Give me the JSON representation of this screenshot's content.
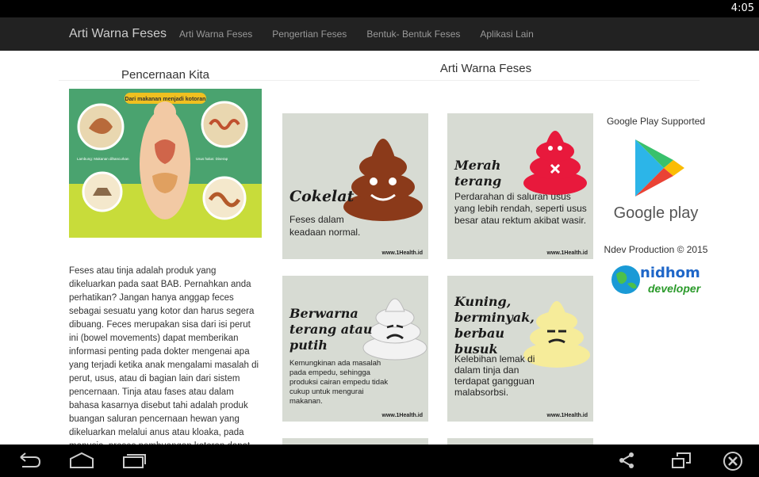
{
  "status_bar": {
    "time": "4:05"
  },
  "navbar": {
    "brand": "Arti Warna Feses",
    "links": [
      "Arti Warna Feses",
      "Pengertian Feses",
      "Bentuk- Bentuk Feses",
      "Aplikasi Lain"
    ]
  },
  "left": {
    "title": "Pencernaan Kita",
    "image_caption": "Dari makanan menjadi kotoran",
    "body": "Feses atau tinja adalah produk yang dikeluarkan pada saat BAB. Pernahkan anda perhatikan? Jangan hanya anggap feces sebagai sesuatu yang kotor dan harus segera dibuang. Feces merupakan sisa dari isi perut ini (bowel movements) dapat memberikan informasi penting pada dokter mengenai apa yang terjadi ketika anak mengalami masalah di perut, usus, atau di bagian lain dari sistem pencernaan. Tinja atau fases atau dalam bahasa kasarnya disebut tahi adalah produk buangan saluran pencernaan hewan yang dikeluarkan melalui anus atau kloaka, pada manusia, proses pembuangan kotoran dapat"
  },
  "main": {
    "title": "Arti Warna Feses",
    "cards": [
      {
        "heading": "Cokelat",
        "desc": "Feses dalam keadaan normal.",
        "site": "www.1Health.id",
        "color": "#8b3a1a"
      },
      {
        "heading": "Merah terang",
        "desc": "Perdarahan di saluran usus yang lebih rendah, seperti usus besar atau rektum akibat wasir.",
        "site": "www.1Health.id",
        "color": "#e8193c"
      },
      {
        "heading": "Berwarna terang atau putih",
        "desc": "Kemungkinan ada masalah pada empedu, sehingga produksi cairan empedu tidak cukup untuk mengurai makanan.",
        "site": "www.1Health.id",
        "color": "#f2f2f2"
      },
      {
        "heading": "Kuning, berminyak, berbau busuk",
        "desc": "Kelebihan lemak di dalam tinja dan terdapat gangguan malabsorbsi.",
        "site": "www.1Health.id",
        "color": "#f6ec9a"
      }
    ]
  },
  "right": {
    "google_play_label": "Google Play Supported",
    "google_play_word": "Google play",
    "copyright": "Ndev Production © 2015",
    "dev_name": "nidhom",
    "dev_sub": "developer"
  },
  "icons": {
    "back": "back-icon",
    "home": "home-icon",
    "recents": "recent-apps-icon",
    "share": "share-icon",
    "screen": "screen-rotate-icon",
    "close": "close-icon"
  }
}
